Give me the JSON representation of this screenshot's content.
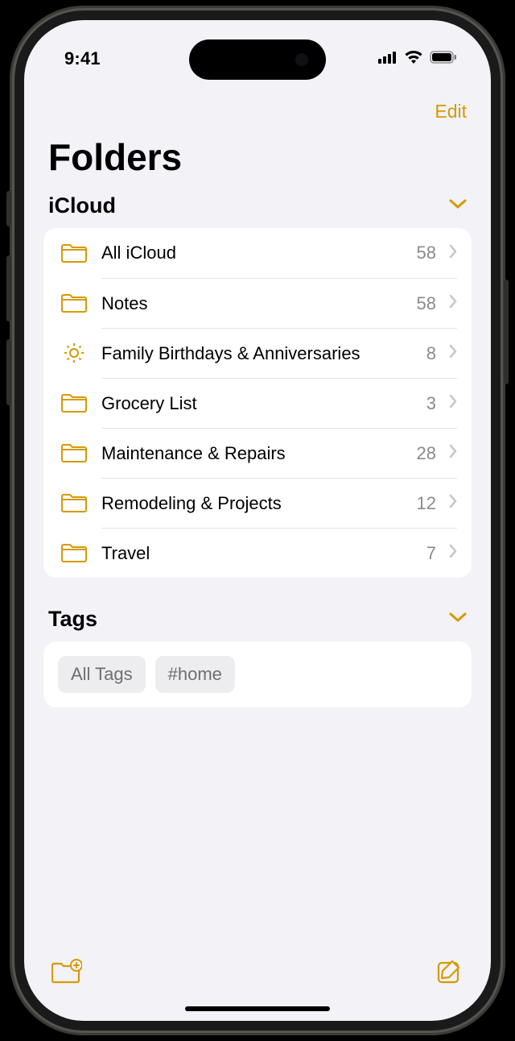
{
  "status": {
    "time": "9:41"
  },
  "nav": {
    "edit": "Edit"
  },
  "page_title": "Folders",
  "sections": {
    "icloud": {
      "title": "iCloud",
      "folders": [
        {
          "name": "All iCloud",
          "count": "58",
          "icon": "folder"
        },
        {
          "name": "Notes",
          "count": "58",
          "icon": "folder"
        },
        {
          "name": "Family Birthdays & Anniversaries",
          "count": "8",
          "icon": "gear"
        },
        {
          "name": "Grocery List",
          "count": "3",
          "icon": "folder"
        },
        {
          "name": "Maintenance & Repairs",
          "count": "28",
          "icon": "folder"
        },
        {
          "name": "Remodeling & Projects",
          "count": "12",
          "icon": "folder"
        },
        {
          "name": "Travel",
          "count": "7",
          "icon": "folder"
        }
      ]
    },
    "tags": {
      "title": "Tags",
      "items": [
        "All Tags",
        "#home"
      ]
    }
  },
  "colors": {
    "accent": "#d69a00"
  }
}
